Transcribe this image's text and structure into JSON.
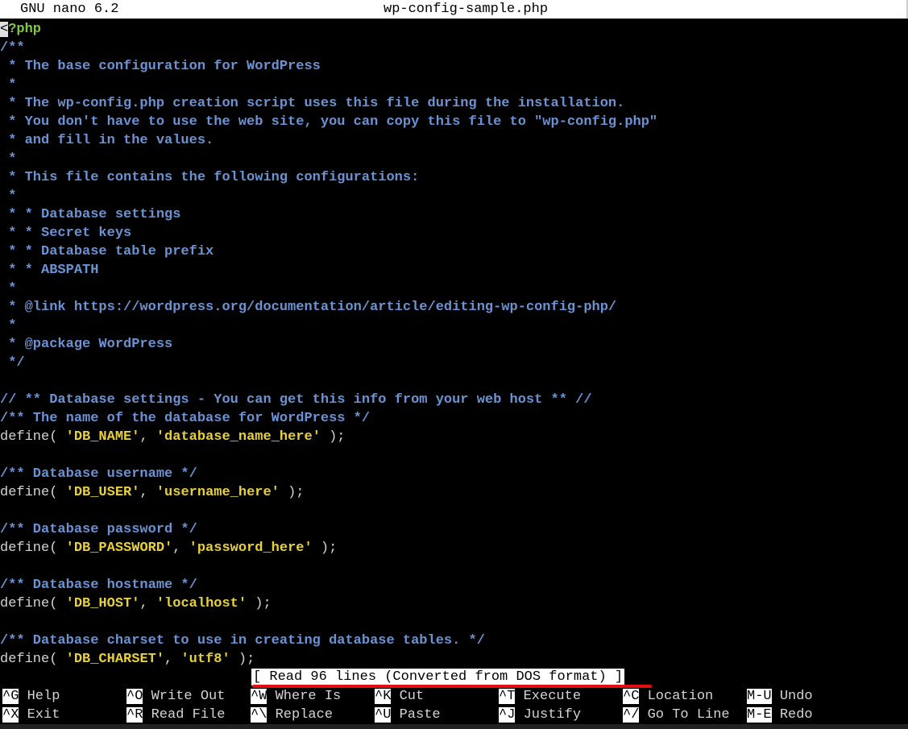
{
  "title_bar": {
    "app": "GNU nano 6.2",
    "filename": "wp-config-sample.php"
  },
  "editor": {
    "cursor_char": "<",
    "line1_tag": "?php",
    "comment_lines": [
      "/**",
      " * The base configuration for WordPress",
      " *",
      " * The wp-config.php creation script uses this file during the installation.",
      " * You don't have to use the web site, you can copy this file to \"wp-config.php\"",
      " * and fill in the values.",
      " *",
      " * This file contains the following configurations:",
      " *",
      " * * Database settings",
      " * * Secret keys",
      " * * Database table prefix",
      " * * ABSPATH",
      " *",
      " * @link https://wordpress.org/documentation/article/editing-wp-config-php/",
      " *",
      " * @package WordPress",
      " */"
    ],
    "db_section_comment": "// ** Database settings - You can get this info from your web host ** //",
    "defines": [
      {
        "comment": "/** The name of the database for WordPress */",
        "prefix": "define( ",
        "key": "'DB_NAME'",
        "sep": ", ",
        "value": "'database_name_here'",
        "suffix": " );"
      },
      {
        "comment": "/** Database username */",
        "prefix": "define( ",
        "key": "'DB_USER'",
        "sep": ", ",
        "value": "'username_here'",
        "suffix": " );"
      },
      {
        "comment": "/** Database password */",
        "prefix": "define( ",
        "key": "'DB_PASSWORD'",
        "sep": ", ",
        "value": "'password_here'",
        "suffix": " );"
      },
      {
        "comment": "/** Database hostname */",
        "prefix": "define( ",
        "key": "'DB_HOST'",
        "sep": ", ",
        "value": "'localhost'",
        "suffix": " );"
      },
      {
        "comment": "/** Database charset to use in creating database tables. */",
        "prefix": "define( ",
        "key": "'DB_CHARSET'",
        "sep": ", ",
        "value": "'utf8'",
        "suffix": " );"
      }
    ]
  },
  "status_message": "[ Read 96 lines (Converted from DOS format) ]",
  "shortcuts": [
    {
      "key": "^G",
      "label": "Help"
    },
    {
      "key": "^X",
      "label": "Exit"
    },
    {
      "key": "^O",
      "label": "Write Out"
    },
    {
      "key": "^R",
      "label": "Read File"
    },
    {
      "key": "^W",
      "label": "Where Is"
    },
    {
      "key": "^\\",
      "label": "Replace"
    },
    {
      "key": "^K",
      "label": "Cut"
    },
    {
      "key": "^U",
      "label": "Paste"
    },
    {
      "key": "^T",
      "label": "Execute"
    },
    {
      "key": "^J",
      "label": "Justify"
    },
    {
      "key": "^C",
      "label": "Location"
    },
    {
      "key": "^/",
      "label": "Go To Line"
    },
    {
      "key": "M-U",
      "label": "Undo"
    },
    {
      "key": "M-E",
      "label": "Redo"
    }
  ],
  "colors": {
    "comment": "#6b93d3",
    "string": "#e8d03a",
    "php_tag": "#7fc848",
    "annotation": "#e01010"
  }
}
